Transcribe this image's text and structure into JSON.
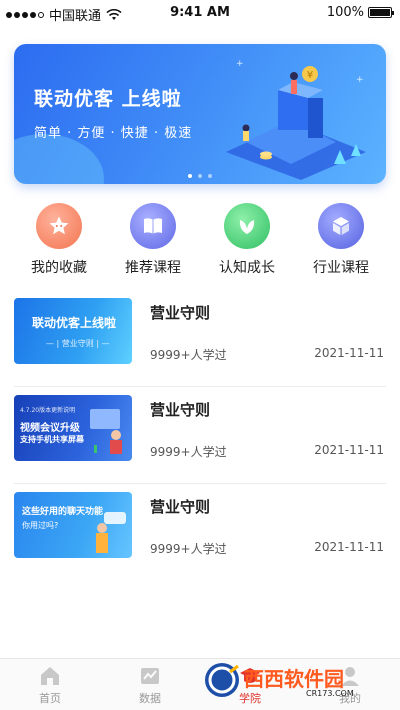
{
  "status_bar": {
    "carrier": "中国联通",
    "time": "9:41 AM",
    "battery": "100%"
  },
  "banner": {
    "title": "联动优客 上线啦",
    "subtitle": "简单 · 方便 · 快捷 · 极速",
    "dots": 3,
    "active_dot": 0,
    "accent": "#2c6cf0"
  },
  "shortcuts": [
    {
      "label": "我的收藏",
      "icon": "star-icon",
      "color": "#f4886b"
    },
    {
      "label": "推荐课程",
      "icon": "book-icon",
      "color": "#7a83f0"
    },
    {
      "label": "认知成长",
      "icon": "leaf-icon",
      "color": "#4fcf7c"
    },
    {
      "label": "行业课程",
      "icon": "cube-icon",
      "color": "#6a78ee"
    }
  ],
  "courses": [
    {
      "title": "营业守则",
      "learners": "9999+人学过",
      "date": "2021-11-11",
      "thumb_lines": [
        "联动优客上线啦",
        "— | 营业守则 | —"
      ]
    },
    {
      "title": "营业守则",
      "learners": "9999+人学过",
      "date": "2021-11-11",
      "thumb_lines": [
        "4.7.20版本更新说明",
        "视频会议升级",
        "支持手机共享屏幕"
      ]
    },
    {
      "title": "营业守则",
      "learners": "9999+人学过",
      "date": "2021-11-11",
      "thumb_lines": [
        "这些好用的聊天功能",
        "你用过吗?"
      ]
    }
  ],
  "tabbar": [
    {
      "label": "首页",
      "icon": "home-icon",
      "active": false
    },
    {
      "label": "数据",
      "icon": "chart-icon",
      "active": false
    },
    {
      "label": "学院",
      "icon": "academy-icon",
      "active": true
    },
    {
      "label": "我的",
      "icon": "user-icon",
      "active": false
    }
  ],
  "watermark": {
    "text": "西西软件园",
    "url_text": "CR173.COM"
  }
}
